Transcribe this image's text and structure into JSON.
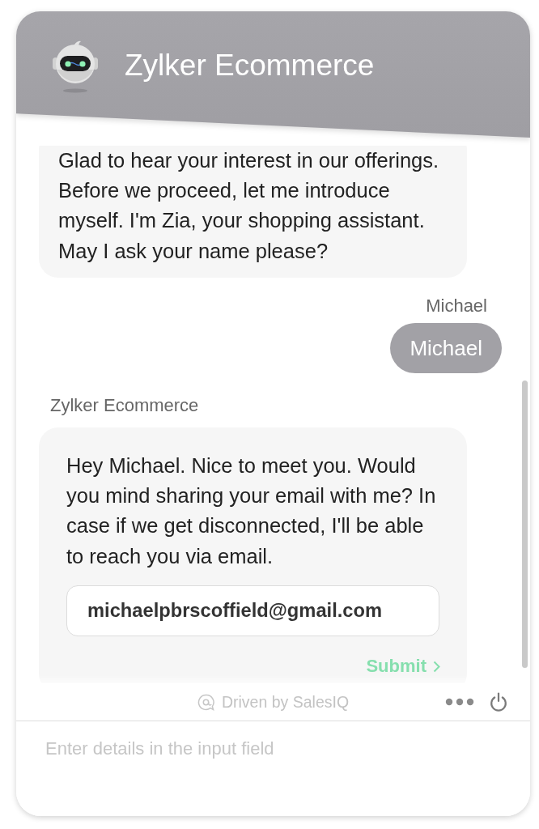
{
  "header": {
    "title": "Zylker Ecommerce"
  },
  "messages": [
    {
      "kind": "bot_text",
      "text": "Glad to hear your interest in our offerings. Before we proceed, let me introduce myself. I'm Zia, your shopping assistant. May I ask your name please?"
    },
    {
      "kind": "visitor_text",
      "sender": "Michael",
      "text": "Michael"
    },
    {
      "kind": "bot_email_form",
      "sender": "Zylker Ecommerce",
      "text": "Hey Michael. Nice to meet you. Would you mind sharing your email with me? In case if we get disconnected, I'll be able to reach you via email.",
      "field": {
        "value": "michaelpbrscoffield@gmail.com"
      },
      "submit": {
        "label": "Submit"
      }
    }
  ],
  "footer": {
    "branding": "Driven by SalesIQ"
  },
  "composer": {
    "placeholder": "Enter details in the input field"
  }
}
